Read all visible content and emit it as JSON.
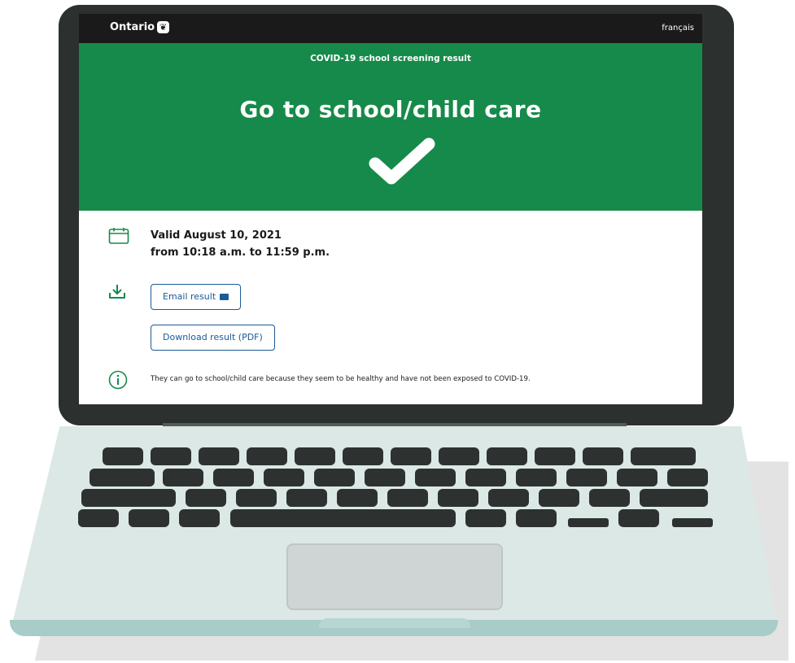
{
  "header": {
    "brand": "Ontario",
    "brand_logo": "trillium-icon",
    "language_link": "français"
  },
  "banner": {
    "label": "COVID-19 school screening result",
    "title": "Go to school/child care",
    "color": "#168a4a",
    "icon": "checkmark-icon"
  },
  "validity": {
    "icon": "calendar-icon",
    "line1": "Valid August 10, 2021",
    "line2": "from 10:18 a.m. to 11:59 p.m."
  },
  "actions": {
    "icon": "download-icon",
    "email_label": "Email result",
    "email_icon": "mail-icon",
    "download_label": "Download result (PDF)"
  },
  "info": {
    "icon": "info-icon",
    "text": "They can go to school/child care because they seem to be healthy and have not been exposed to COVID-19."
  },
  "colors": {
    "accent_green": "#168a4a",
    "link_blue": "#1a5a96",
    "header_black": "#1a1a1a"
  }
}
